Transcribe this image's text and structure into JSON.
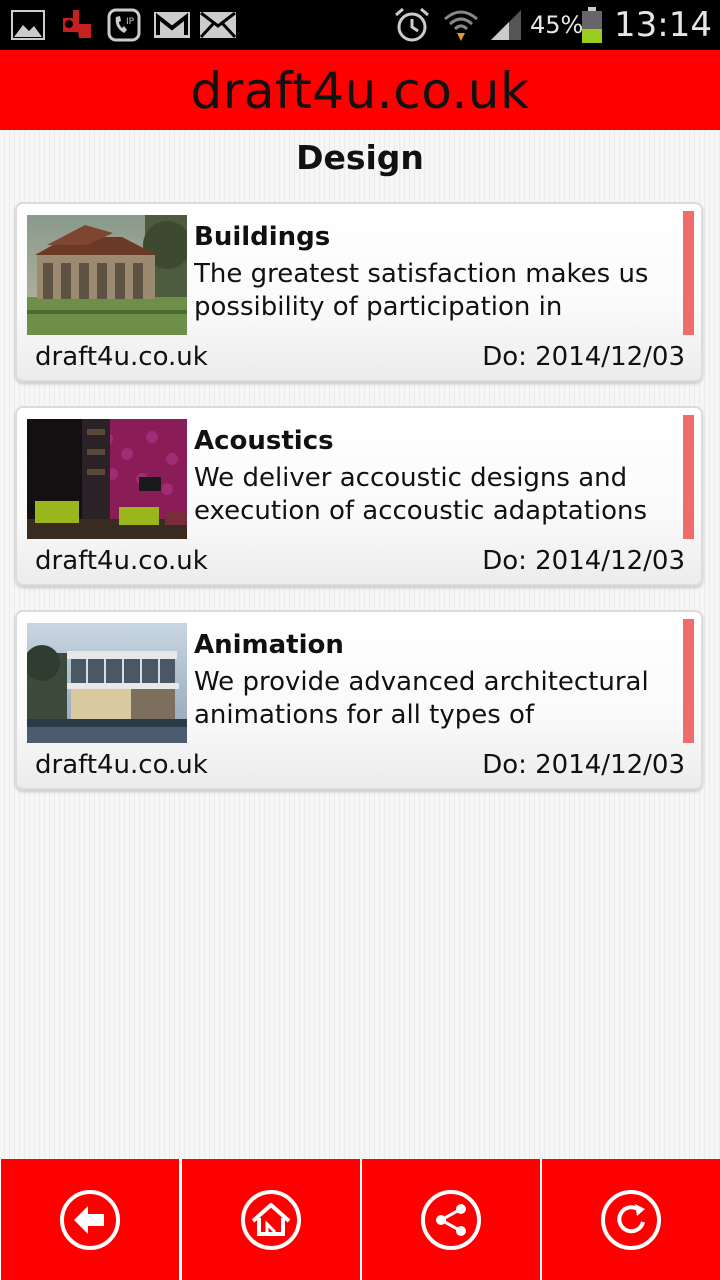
{
  "status_bar": {
    "battery_percent": "45%",
    "time": "13:14",
    "icons": [
      "gallery-icon",
      "draft4u-app-icon",
      "voicemail-icon",
      "gmail-icon",
      "email-icon",
      "alarm-icon",
      "wifi-icon",
      "signal-icon",
      "battery-icon"
    ]
  },
  "header": {
    "site_title": "draft4u.co.uk"
  },
  "page": {
    "title": "Design"
  },
  "colors": {
    "brand_red": "#ff0000",
    "accent_bar": "#f06b6b"
  },
  "articles": [
    {
      "title": "Buildings",
      "description": "The greatest satisfaction makes us possibility of participation in",
      "source": "draft4u.co.uk",
      "date": "Do: 2014/12/03",
      "image": "building-photo"
    },
    {
      "title": "Acoustics",
      "description": "We deliver accoustic designs and execution of accoustic adaptations of:",
      "source": "draft4u.co.uk",
      "date": "Do: 2014/12/03",
      "image": "acoustics-photo"
    },
    {
      "title": "Animation",
      "description": "We provide advanced architectural animations for all types of",
      "source": "draft4u.co.uk",
      "date": "Do: 2014/12/03",
      "image": "animation-photo"
    }
  ],
  "toolbar": {
    "buttons": [
      "back-icon",
      "home-icon",
      "share-icon",
      "refresh-icon"
    ]
  }
}
